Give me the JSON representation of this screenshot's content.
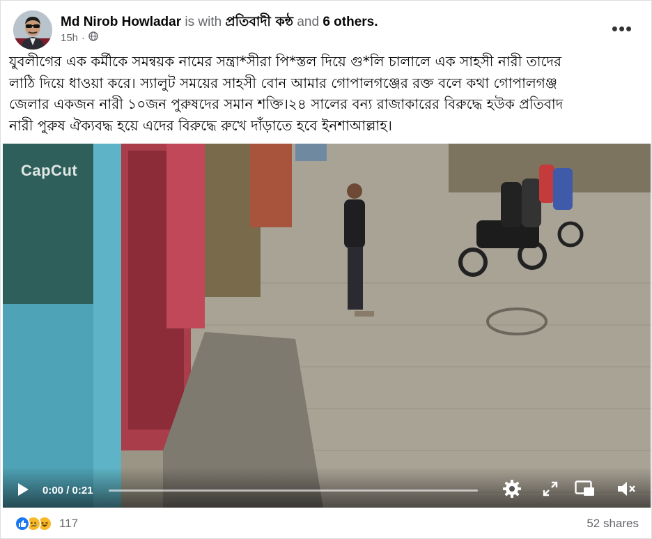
{
  "post": {
    "author": "Md Nirob Howladar",
    "with_text": "is with",
    "tagged_page": "প্রতিবাদী কন্ঠ",
    "and_text": "and",
    "others": "6 others.",
    "time": "15h",
    "privacy_icon": "globe-icon",
    "more_icon": "more-options-icon",
    "more_label": "•••",
    "text_lines": [
      "যুবলীগের এক কর্মীকে সমন্বয়ক নামের সন্ত্রা*সীরা পি*স্তল দিয়ে গু*লি চালালে  এক সাহসী নারী তাদের",
      "লাঠি দিয়ে ধাওয়া করে। স্যালুট সময়ের সাহসী বোন আমার গোপালগঞ্জের রক্ত বলে কথা গোপালগঞ্জ",
      "জেলার একজন নারী ১০জন পুরুষদের সমান শক্তি।২৪ সালের  বন্য রাজাকারের বিরুদ্ধে হউক প্রতিবাদ",
      "নারী পুরুষ ঐক্যবদ্ধ হয়ে এদের বিরুদ্ধে রুখে দাঁড়াতে হবে ইনশাআল্লাহ।"
    ]
  },
  "video": {
    "watermark": "CapCut",
    "time_display": "0:00 / 0:21",
    "progress": 0.0,
    "controls": [
      "play-icon",
      "settings-icon",
      "expand-icon",
      "picture-in-picture-icon",
      "mute-icon"
    ]
  },
  "footer": {
    "reactions": [
      "like-icon",
      "sad-icon",
      "haha-icon"
    ],
    "reaction_count": "117",
    "shares": "52 shares"
  },
  "colors": {
    "text": "#050505",
    "muted": "#65676b",
    "like_blue": "#1877f2",
    "emoji_yellow": "#f7b928"
  }
}
